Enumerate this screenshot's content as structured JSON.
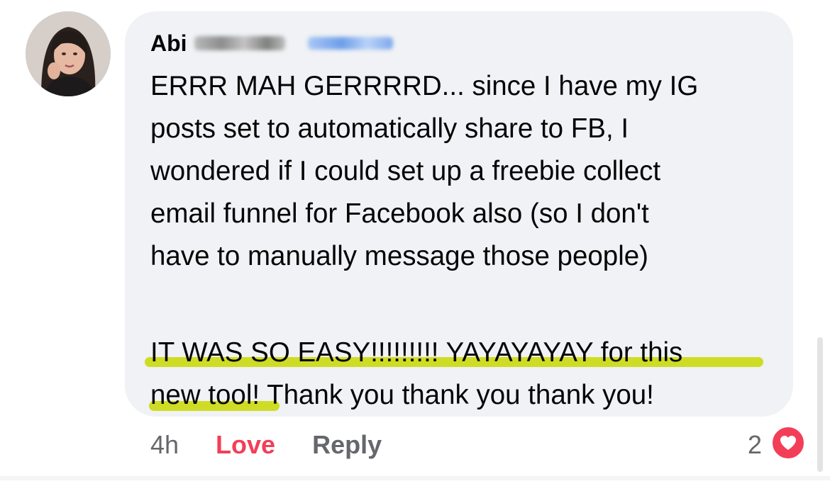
{
  "author": {
    "name": "Abi",
    "avatar_icon": "profile-photo"
  },
  "comment": {
    "paragraph1": "ERRR MAH GERRRRD... since I have my IG\nposts set to automatically share to FB, I\nwondered if I could set up a freebie collect\nemail funnel for Facebook also (so I don't\nhave to manually message those people)",
    "paragraph2_line1": "IT WAS SO EASY!!!!!!!!! YAYAYAYAY for this",
    "paragraph2_line2": "new tool! Thank you thank you thank you!"
  },
  "actions": {
    "time": "4h",
    "love_label": "Love",
    "reply_label": "Reply"
  },
  "reactions": {
    "count": "2",
    "icon": "heart-icon",
    "badge_color": "#f33e58"
  },
  "colors": {
    "bubble": "#f0f2f5",
    "highlight": "#cfdc25",
    "love": "#f33e58",
    "muted": "#65676b"
  }
}
